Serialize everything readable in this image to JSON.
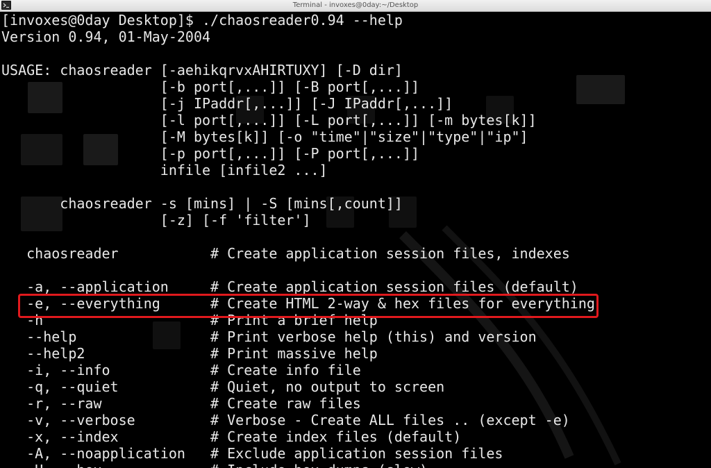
{
  "window": {
    "title": "Terminal - invoxes@0day:~/Desktop"
  },
  "terminal": {
    "lines": [
      "[invoxes@0day Desktop]$ ./chaosreader0.94 --help",
      "Version 0.94, 01-May-2004",
      "",
      "USAGE: chaosreader [-aehikqrvxAHIRTUXY] [-D dir]",
      "                   [-b port[,...]] [-B port[,...]]",
      "                   [-j IPaddr[,...]] [-J IPaddr[,...]]",
      "                   [-l port[,...]] [-L port[,...]] [-m bytes[k]]",
      "                   [-M bytes[k]] [-o \"time\"|\"size\"|\"type\"|\"ip\"]",
      "                   [-p port[,...]] [-P port[,...]]",
      "                   infile [infile2 ...]",
      "",
      "       chaosreader -s [mins] | -S [mins[,count]]",
      "                   [-z] [-f 'filter']",
      "",
      "   chaosreader           # Create application session files, indexes",
      "",
      "   -a, --application     # Create application session files (default)",
      "   -e, --everything      # Create HTML 2-way & hex files for everything",
      "   -h                    # Print a brief help",
      "   --help                # Print verbose help (this) and version",
      "   --help2               # Print massive help",
      "   -i, --info            # Create info file",
      "   -q, --quiet           # Quiet, no output to screen",
      "   -r, --raw             # Create raw files",
      "   -v, --verbose         # Verbose - Create ALL files .. (except -e)",
      "   -x, --index           # Create index files (default)",
      "   -A, --noapplication   # Exclude application session files",
      "   -H, --hex             # Include hex dumps (slow)"
    ],
    "highlighted_line": "-e, --everything"
  },
  "icons": {
    "app": "terminal-icon"
  }
}
